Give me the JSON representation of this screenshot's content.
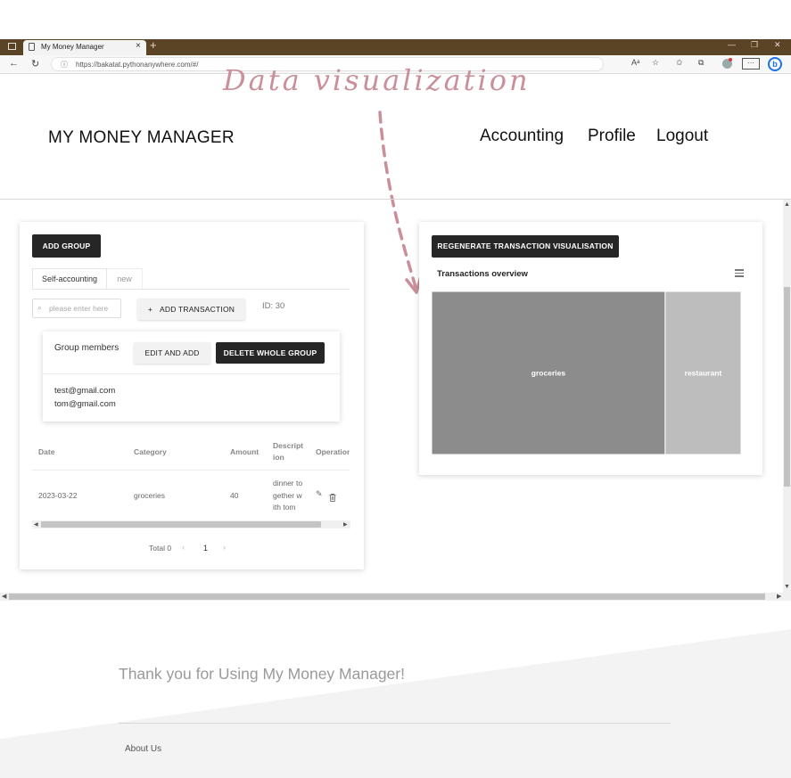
{
  "browser": {
    "tab_title": "My Money Manager",
    "tab_close": "×",
    "new_tab": "+",
    "url": "https://bakatat.pythonanywhere.com/#/",
    "read_aloud": "Aᵃ",
    "more": "···",
    "bing": "b"
  },
  "annotation": {
    "text": "Data visualization"
  },
  "header": {
    "brand": "MY MONEY MANAGER",
    "nav": [
      "Accounting",
      "Profile",
      "Logout"
    ]
  },
  "group_panel": {
    "add_group_label": "ADD GROUP",
    "tabs": [
      "Self-accounting",
      "new"
    ],
    "search_placeholder": "please enter here",
    "add_transaction_label": "ADD TRANSACTION",
    "add_icon": "+",
    "id_label": "ID: 30",
    "members_title": "Group members",
    "edit_label": "EDIT AND ADD",
    "delete_label": "DELETE WHOLE GROUP",
    "members": [
      "test@gmail.com",
      "tom@gmail.com"
    ],
    "table": {
      "columns": [
        "Date",
        "Category",
        "Amount",
        "Description",
        "Operation"
      ],
      "column_display": [
        "Date",
        "Category",
        "Amount",
        "Descript\nion",
        "Operation"
      ],
      "rows": [
        {
          "date": "2023-03-22",
          "category": "groceries",
          "amount": "40",
          "description": "dinner together with tom",
          "description_display": "dinner to\ngether w\nith tom"
        }
      ]
    },
    "pager": {
      "total": "Total 0",
      "prev": "‹",
      "page": "1",
      "next": "›"
    }
  },
  "viz_panel": {
    "regenerate_label": "REGENERATE TRANSACTION VISUALISATION",
    "chart_title": "Transactions overview"
  },
  "chart_data": {
    "type": "treemap",
    "title": "Transactions overview",
    "categories": [
      "groceries",
      "restaurant"
    ],
    "values": [
      40,
      13
    ],
    "colors": [
      "#8c8c8c",
      "#bdbdbd"
    ]
  },
  "footer": {
    "thanks": "Thank you for Using My Money Manager!",
    "about": "About Us"
  }
}
